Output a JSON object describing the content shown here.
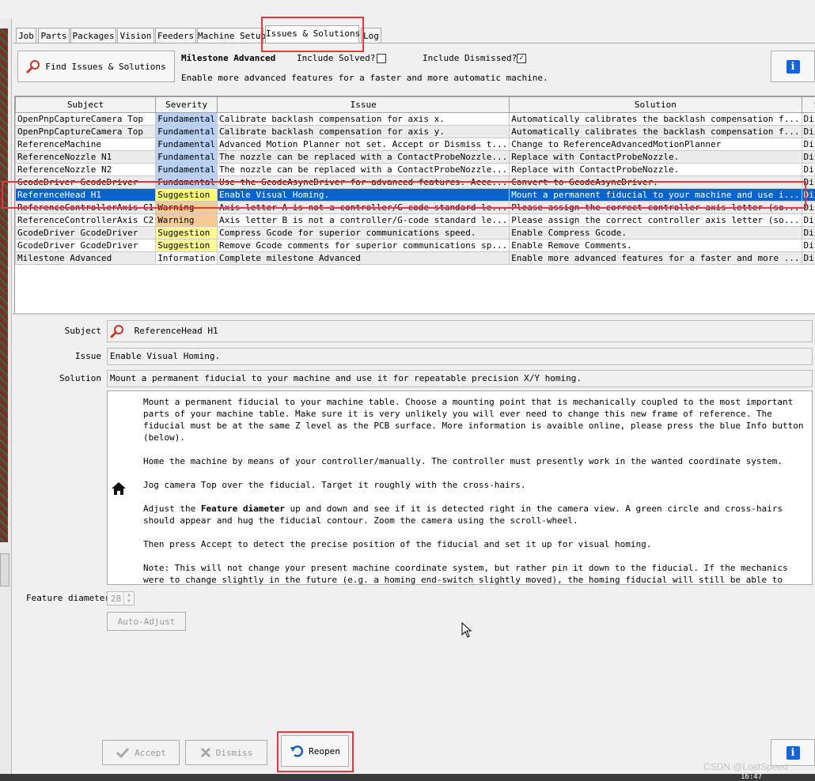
{
  "tabs": [
    {
      "label": "Job"
    },
    {
      "label": "Parts"
    },
    {
      "label": "Packages"
    },
    {
      "label": "Vision"
    },
    {
      "label": "Feeders"
    },
    {
      "label": "Machine Setup"
    },
    {
      "label": "Issues & Solutions",
      "active": true
    },
    {
      "label": "Log"
    }
  ],
  "toolbar": {
    "find_button": "Find Issues & Solutions",
    "milestone": "Milestone Advanced",
    "include_solved_label": "Include Solved?",
    "include_solved_checked": false,
    "include_dismissed_label": "Include Dismissed?",
    "include_dismissed_checked": true,
    "milestone_description": "Enable more advanced features for a faster and more automatic machine."
  },
  "table": {
    "columns": [
      "Subject",
      "Severity",
      "Issue",
      "Solution",
      "State"
    ],
    "rows": [
      {
        "subject": "OpenPnpCaptureCamera Top",
        "severity": "Fundamental",
        "issue": "Calibrate backlash compensation for axis x.",
        "solution": "Automatically calibrates the backlash compensation f...",
        "state": "Dismissed"
      },
      {
        "subject": "OpenPnpCaptureCamera Top",
        "severity": "Fundamental",
        "issue": "Calibrate backlash compensation for axis y.",
        "solution": "Automatically calibrates the backlash compensation f...",
        "state": "Dismissed"
      },
      {
        "subject": "ReferenceMachine",
        "severity": "Fundamental",
        "issue": "Advanced Motion Planner not set. Accept or Dismiss t...",
        "solution": "Change to ReferenceAdvancedMotionPlanner",
        "state": "Dismissed"
      },
      {
        "subject": "ReferenceNozzle N1",
        "severity": "Fundamental",
        "issue": "The nozzle can be replaced with a ContactProbeNozzle...",
        "solution": "Replace with ContactProbeNozzle.",
        "state": "Dismissed"
      },
      {
        "subject": "ReferenceNozzle N2",
        "severity": "Fundamental",
        "issue": "The nozzle can be replaced with a ContactProbeNozzle...",
        "solution": "Replace with ContactProbeNozzle.",
        "state": "Dismissed"
      },
      {
        "subject": "GcodeDriver GcodeDriver",
        "severity": "Fundamental",
        "issue": "Use the GcodeAsyncDriver for advanced features. Acce...",
        "solution": "Convert to GcodeAsyncDriver.",
        "state": "Dismissed"
      },
      {
        "subject": "ReferenceHead H1",
        "severity": "Suggestion",
        "issue": "Enable Visual Homing.",
        "solution": "Mount a permanent fiducial to your machine and use i...",
        "state": "Dismissed",
        "selected": true
      },
      {
        "subject": "ReferenceControllerAxis C1",
        "severity": "Warning",
        "issue": "Axis letter A is not a controller/G-code standard le...",
        "solution": "Please assign the correct controller axis letter (so...",
        "state": "Dismissed"
      },
      {
        "subject": "ReferenceControllerAxis C2",
        "severity": "Warning",
        "issue": "Axis letter B is not a controller/G-code standard le...",
        "solution": "Please assign the correct controller axis letter (so...",
        "state": "Dismissed"
      },
      {
        "subject": "GcodeDriver GcodeDriver",
        "severity": "Suggestion",
        "issue": "Compress Gcode for superior communications speed.",
        "solution": "Enable Compress Gcode.",
        "state": "Dismissed"
      },
      {
        "subject": "GcodeDriver GcodeDriver",
        "severity": "Suggestion",
        "issue": "Remove Gcode comments for superior communications sp...",
        "solution": "Enable Remove Comments.",
        "state": "Dismissed"
      },
      {
        "subject": "Milestone Advanced",
        "severity": "Information",
        "issue": "Complete milestone Advanced",
        "solution": "Enable more advanced features for a faster and more ...",
        "state": "Dismissed"
      }
    ]
  },
  "detail": {
    "subject_label": "Subject",
    "subject_value": "ReferenceHead H1",
    "issue_label": "Issue",
    "issue_value": "Enable Visual Homing.",
    "solution_label": "Solution",
    "solution_value": "Mount a permanent fiducial to your machine and use it for repeatable precision X/Y homing.",
    "instructions": {
      "p1": "Mount a permanent fiducial to your machine table. Choose a mounting point that is mechanically coupled to the most important parts of your machine table. Make sure it is very unlikely you will ever need to change this new frame of reference. The fiducial must be at the same Z level as the PCB surface. More information is avaible online, please press the blue Info button (below).",
      "p2": "Home the machine by means of your controller/manually. The controller must presently work in the wanted coordinate system.",
      "p3": "Jog camera Top over the fiducial. Target it roughly with the cross-hairs.",
      "p4_pre": "Adjust the ",
      "p4_bold": "Feature diameter",
      "p4_post": " up and down and see if it is detected right in the camera view. A green circle and cross-hairs should appear and hug the fiducial contour. Zoom the camera using the scroll-wheel.",
      "p5": "Then press Accept to detect the precise position of the fiducial and set it up for visual homing.",
      "p6": "Note: This will not change your present machine coordinate system, but rather pin it down to the fiducial. If the mechanics were to change slightly in the future (e.g. a homing end-switch slightly moved), the homing fiducial will still be able to precisely preserve the frame of reference in X and Y."
    },
    "feature_diameter_label": "Feature diameter",
    "feature_diameter_value": "28",
    "auto_adjust_button": "Auto-Adjust"
  },
  "actions": {
    "accept": "Accept",
    "dismiss": "Dismiss",
    "reopen": "Reopen"
  },
  "watermark": "CSDN @LostSpeed",
  "clock": "16:47",
  "colors": {
    "selection": "#0a64c8",
    "fundamental": "#b9d1f5",
    "warning": "#f6cb98",
    "suggestion": "#fdfd96",
    "info_button": "#1464d6",
    "highlight_box": "#e0393e"
  }
}
